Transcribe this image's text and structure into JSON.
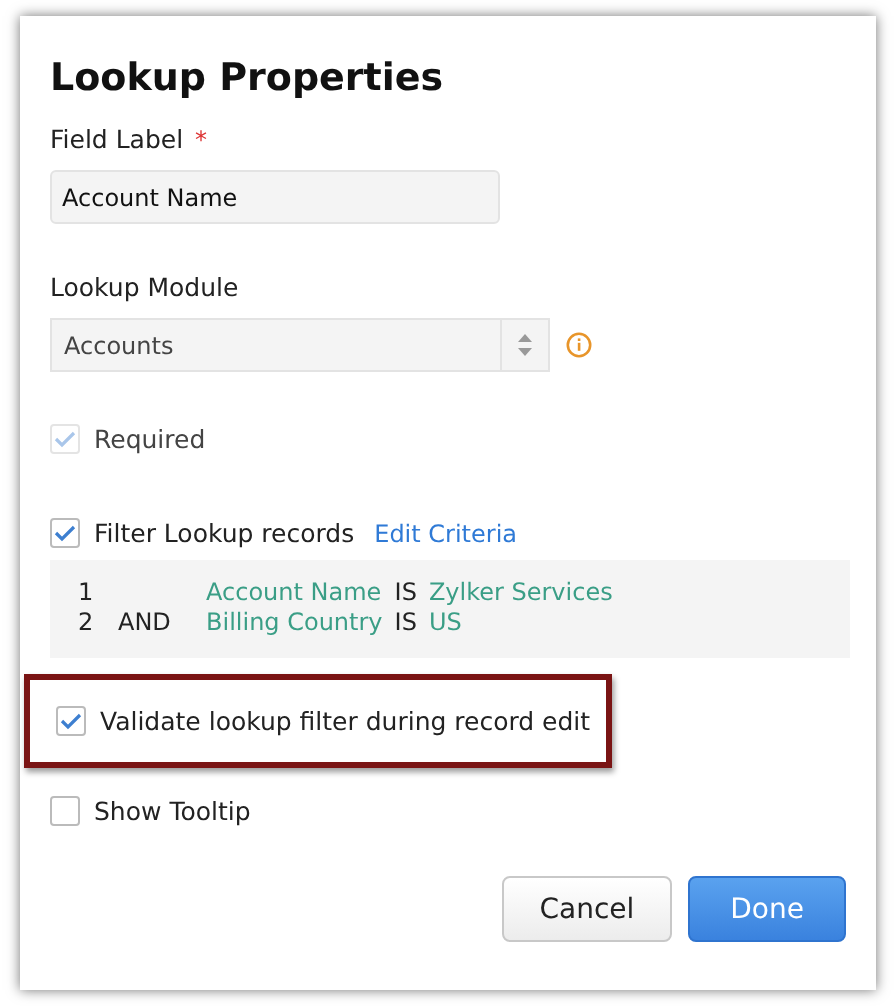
{
  "dialog": {
    "title": "Lookup Properties"
  },
  "field_label": {
    "label": "Field Label",
    "required_mark": "*",
    "value": "Account Name"
  },
  "lookup_module": {
    "label": "Lookup Module",
    "value": "Accounts"
  },
  "required": {
    "label": "Required",
    "checked": true,
    "disabled": true
  },
  "filter": {
    "label": "Filter Lookup records",
    "checked": true,
    "disabled": false,
    "link": "Edit Criteria"
  },
  "criteria": [
    {
      "number": "1",
      "field": "Account Name",
      "comparator": "IS",
      "value": "Zylker Services"
    },
    {
      "number": "2",
      "operator": "AND",
      "field": "Billing Country",
      "comparator": "IS",
      "value": "US"
    }
  ],
  "validate": {
    "label": "Validate lookup filter during record edit",
    "checked": true,
    "disabled": false,
    "highlighted": true
  },
  "show_tooltip": {
    "label": "Show Tooltip",
    "checked": false,
    "disabled": false
  },
  "buttons": [
    {
      "label": "Cancel",
      "kind": "secondary"
    },
    {
      "label": "Done",
      "kind": "primary"
    }
  ]
}
